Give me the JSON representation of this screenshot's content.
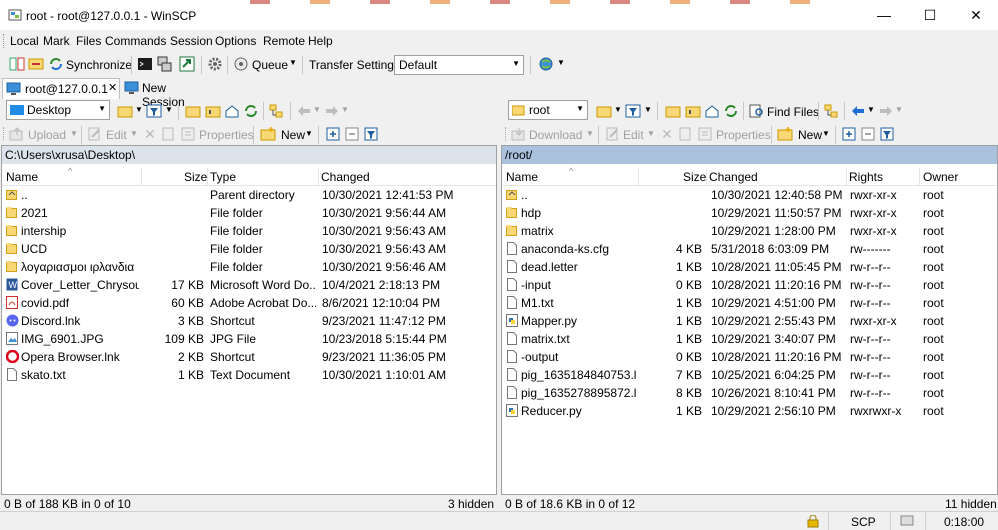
{
  "window": {
    "title": "root - root@127.0.0.1 - WinSCP",
    "minimize": "—",
    "maximize": "☐",
    "close": "✕"
  },
  "menu": [
    "Local",
    "Mark",
    "Files",
    "Commands",
    "Session",
    "Options",
    "Remote",
    "Help"
  ],
  "toolbar": {
    "synchronize": "Synchronize",
    "queue": "Queue",
    "transfer_settings": "Transfer Settings",
    "transfer_value": "Default"
  },
  "tabs": {
    "session": "root@127.0.0.1",
    "new_session": "New Session",
    "close": "✕"
  },
  "left": {
    "location": "Desktop",
    "upload": "Upload",
    "edit": "Edit",
    "properties": "Properties",
    "new": "New",
    "path": "C:\\Users\\xrusa\\Desktop\\",
    "columns": [
      "Name",
      "Size",
      "Type",
      "Changed"
    ],
    "rows": [
      {
        "icon": "parent",
        "name": "..",
        "size": "",
        "type": "Parent directory",
        "changed": "10/30/2021  12:41:53 PM"
      },
      {
        "icon": "folder",
        "name": "2021",
        "size": "",
        "type": "File folder",
        "changed": "10/30/2021  9:56:44 AM"
      },
      {
        "icon": "folder",
        "name": "intership",
        "size": "",
        "type": "File folder",
        "changed": "10/30/2021  9:56:43 AM"
      },
      {
        "icon": "folder",
        "name": "UCD",
        "size": "",
        "type": "File folder",
        "changed": "10/30/2021  9:56:43 AM"
      },
      {
        "icon": "folder",
        "name": "λογαριασμοι ιρλανδια",
        "size": "",
        "type": "File folder",
        "changed": "10/30/2021  9:56:46 AM"
      },
      {
        "icon": "word",
        "name": "Cover_Letter_Chrysoul...",
        "size": "17 KB",
        "type": "Microsoft Word Do...",
        "changed": "10/4/2021  2:18:13 PM"
      },
      {
        "icon": "pdf",
        "name": "covid.pdf",
        "size": "60 KB",
        "type": "Adobe Acrobat Do...",
        "changed": "8/6/2021  12:10:04 PM"
      },
      {
        "icon": "discord",
        "name": "Discord.lnk",
        "size": "3 KB",
        "type": "Shortcut",
        "changed": "9/23/2021  11:47:12 PM"
      },
      {
        "icon": "image",
        "name": "IMG_6901.JPG",
        "size": "109 KB",
        "type": "JPG File",
        "changed": "10/23/2018  5:15:44 PM"
      },
      {
        "icon": "opera",
        "name": "Opera Browser.lnk",
        "size": "2 KB",
        "type": "Shortcut",
        "changed": "9/23/2021  11:36:05 PM"
      },
      {
        "icon": "file",
        "name": "skato.txt",
        "size": "1 KB",
        "type": "Text Document",
        "changed": "10/30/2021  1:10:01 AM"
      }
    ],
    "status_left": "0 B of 188 KB in 0 of 10",
    "status_right": "3 hidden"
  },
  "right": {
    "location": "root",
    "find_files": "Find Files",
    "download": "Download",
    "edit": "Edit",
    "properties": "Properties",
    "new": "New",
    "path": "/root/",
    "columns": [
      "Name",
      "Size",
      "Changed",
      "Rights",
      "Owner"
    ],
    "rows": [
      {
        "icon": "parent",
        "name": "..",
        "size": "",
        "changed": "10/30/2021 12:40:58 PM",
        "rights": "rwxr-xr-x",
        "owner": "root"
      },
      {
        "icon": "folder",
        "name": "hdp",
        "size": "",
        "changed": "10/29/2021 11:50:57 PM",
        "rights": "rwxr-xr-x",
        "owner": "root"
      },
      {
        "icon": "folder",
        "name": "matrix",
        "size": "",
        "changed": "10/29/2021 1:28:00 PM",
        "rights": "rwxr-xr-x",
        "owner": "root"
      },
      {
        "icon": "file",
        "name": "anaconda-ks.cfg",
        "size": "4 KB",
        "changed": "5/31/2018 6:03:09 PM",
        "rights": "rw-------",
        "owner": "root"
      },
      {
        "icon": "file",
        "name": "dead.letter",
        "size": "1 KB",
        "changed": "10/28/2021 11:05:45 PM",
        "rights": "rw-r--r--",
        "owner": "root"
      },
      {
        "icon": "file",
        "name": "-input",
        "size": "0 KB",
        "changed": "10/28/2021 11:20:16 PM",
        "rights": "rw-r--r--",
        "owner": "root"
      },
      {
        "icon": "file",
        "name": "M1.txt",
        "size": "1 KB",
        "changed": "10/29/2021 4:51:00 PM",
        "rights": "rw-r--r--",
        "owner": "root"
      },
      {
        "icon": "python",
        "name": "Mapper.py",
        "size": "1 KB",
        "changed": "10/29/2021 2:55:43 PM",
        "rights": "rwxr-xr-x",
        "owner": "root"
      },
      {
        "icon": "file",
        "name": "matrix.txt",
        "size": "1 KB",
        "changed": "10/29/2021 3:40:07 PM",
        "rights": "rw-r--r--",
        "owner": "root"
      },
      {
        "icon": "file",
        "name": "-output",
        "size": "0 KB",
        "changed": "10/28/2021 11:20:16 PM",
        "rights": "rw-r--r--",
        "owner": "root"
      },
      {
        "icon": "file",
        "name": "pig_1635184840753.l...",
        "size": "7 KB",
        "changed": "10/25/2021 6:04:25 PM",
        "rights": "rw-r--r--",
        "owner": "root"
      },
      {
        "icon": "file",
        "name": "pig_1635278895872.l...",
        "size": "8 KB",
        "changed": "10/26/2021 8:10:41 PM",
        "rights": "rw-r--r--",
        "owner": "root"
      },
      {
        "icon": "python",
        "name": "Reducer.py",
        "size": "1 KB",
        "changed": "10/29/2021 2:56:10 PM",
        "rights": "rwxrwxr-x",
        "owner": "root"
      }
    ],
    "status_left": "0 B of 18.6 KB in 0 of 12",
    "status_right": "11 hidden"
  },
  "bottom": {
    "protocol": "SCP",
    "elapsed": "0:18:00"
  },
  "colors": {
    "path_active": "#b8cce4",
    "path_inactive": "#dce3ea",
    "folder": "#e8b838",
    "accent": "#0078d7"
  }
}
